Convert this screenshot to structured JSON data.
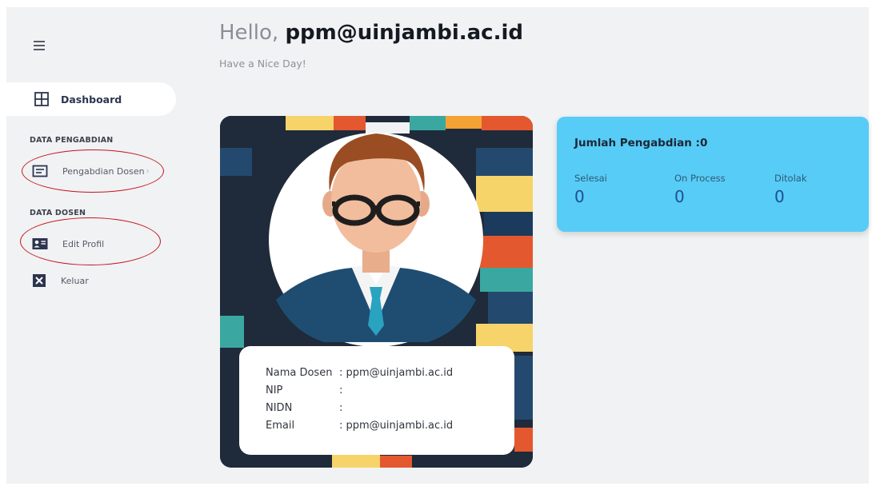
{
  "sidebar": {
    "menu_icon": "hamburger-icon",
    "active_item": {
      "label": "Dashboard",
      "icon": "dashboard-grid-icon"
    },
    "sections": [
      {
        "title": "DATA PENGABDIAN",
        "items": [
          {
            "label": "Pengabdian Dosen",
            "icon": "list-doc-icon",
            "chevron": "›"
          }
        ]
      },
      {
        "title": "DATA DOSEN",
        "items": [
          {
            "label": "Edit Profil",
            "icon": "id-card-icon"
          },
          {
            "label": "Keluar",
            "icon": "close-box-icon"
          }
        ]
      }
    ]
  },
  "header": {
    "greeting_prefix": "Hello,",
    "user": "ppm@uinjambi.ac.id",
    "subtitle": "Have a Nice Day!"
  },
  "profile": {
    "avatar": "user-avatar-illustration",
    "fields": [
      {
        "key": "Nama Dosen",
        "value": ": ppm@uinjambi.ac.id"
      },
      {
        "key": "NIP",
        "value": ":"
      },
      {
        "key": "NIDN",
        "value": ":"
      },
      {
        "key": "Email",
        "value": ": ppm@uinjambi.ac.id"
      }
    ]
  },
  "stats": {
    "title": "Jumlah Pengabdian :0",
    "items": [
      {
        "label": "Selesai",
        "value": "0"
      },
      {
        "label": "On Process",
        "value": "0"
      },
      {
        "label": "Ditolak",
        "value": "0"
      }
    ]
  },
  "colors": {
    "accent_blue": "#57ccf7",
    "annotation_red": "#c3151c",
    "card_dark": "#1f2a3a"
  }
}
